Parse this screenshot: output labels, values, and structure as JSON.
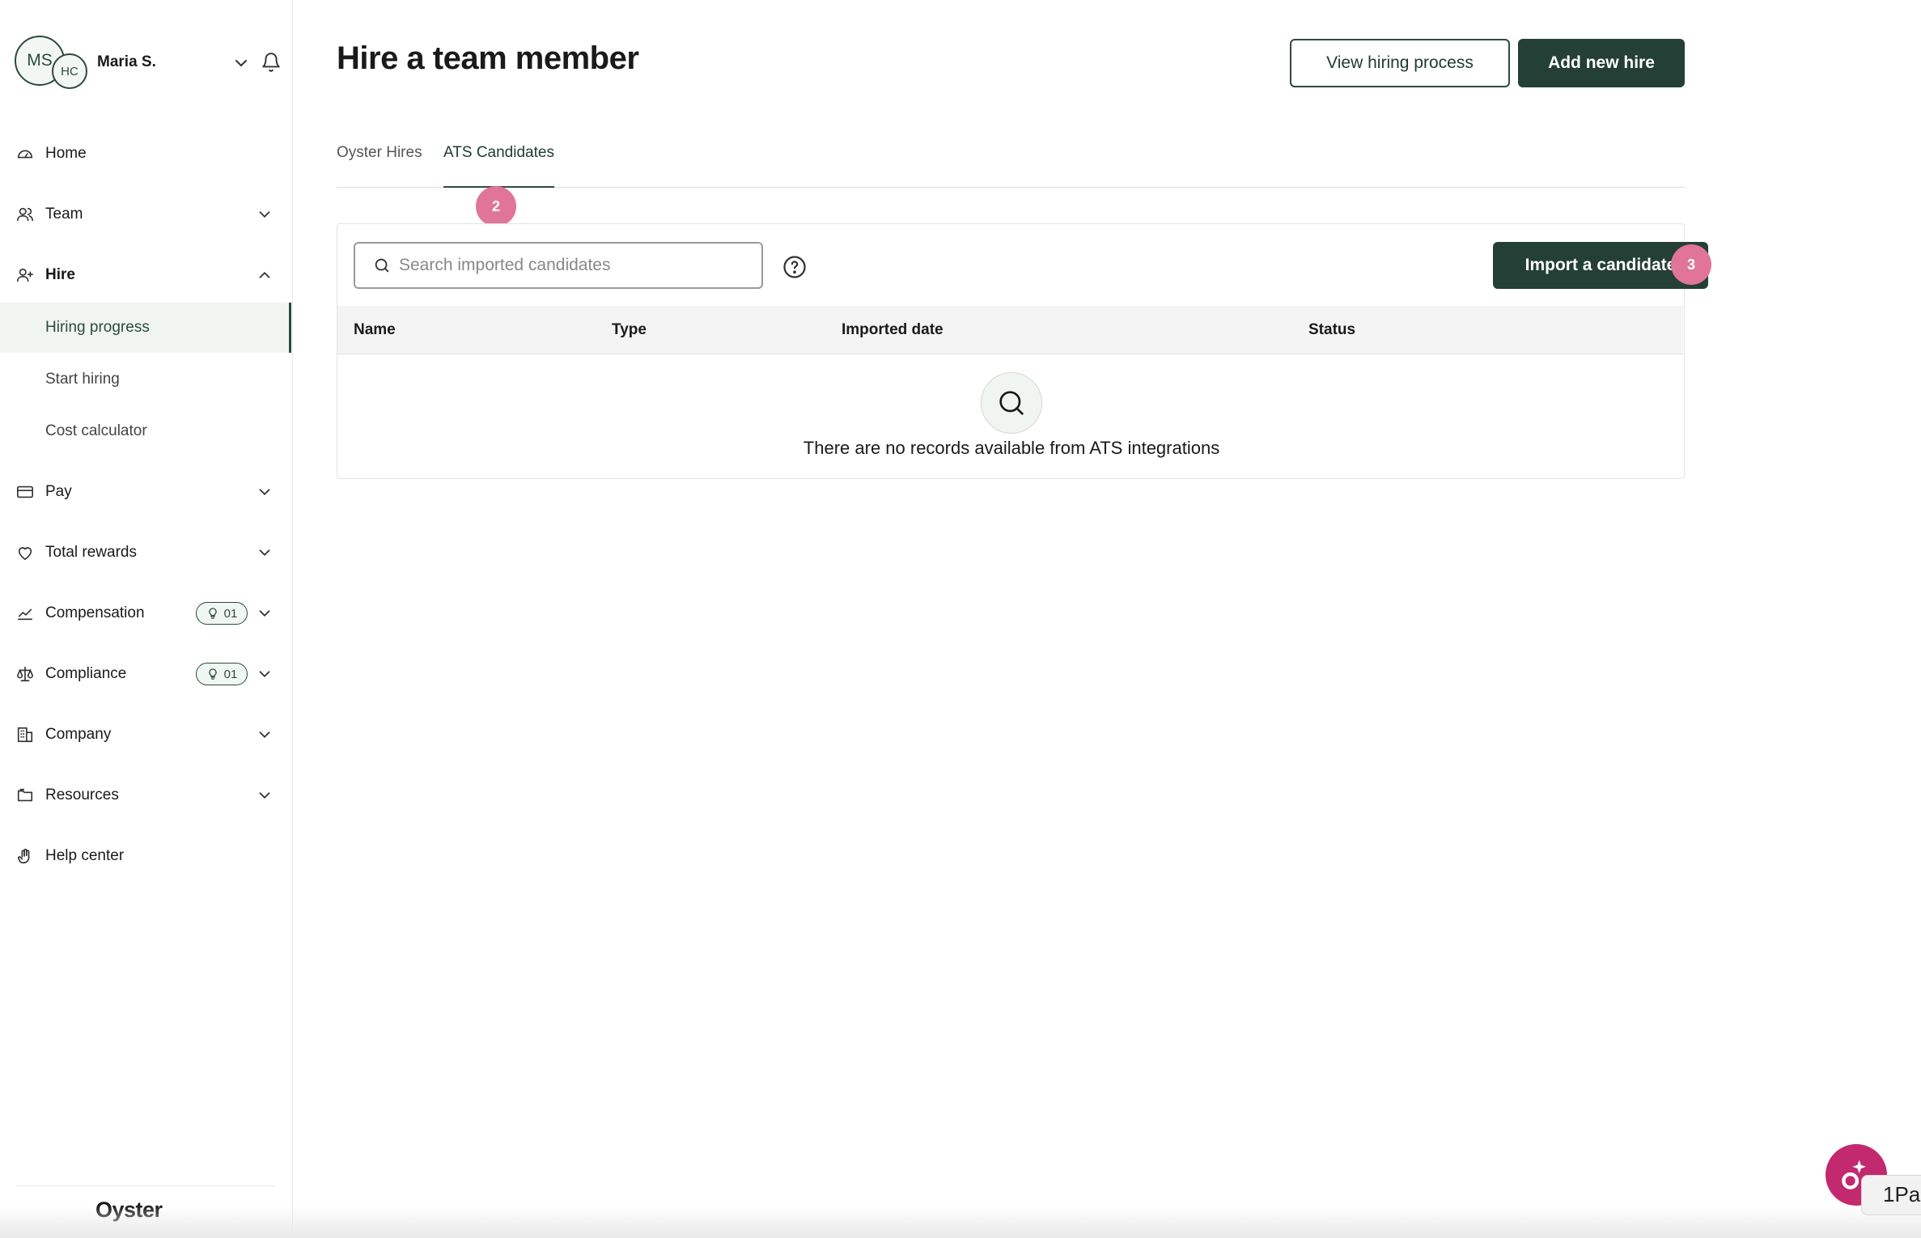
{
  "user": {
    "initials_primary": "MS",
    "initials_secondary": "HC",
    "name": "Maria S."
  },
  "nav": {
    "home": "Home",
    "team": "Team",
    "hire": "Hire",
    "hire_sub": {
      "hiring_progress": "Hiring progress",
      "start_hiring": "Start hiring",
      "cost_calculator": "Cost calculator"
    },
    "pay": "Pay",
    "total_rewards": "Total rewards",
    "compensation": "Compensation",
    "compensation_badge": "01",
    "compliance": "Compliance",
    "compliance_badge": "01",
    "company": "Company",
    "resources": "Resources",
    "help_center": "Help center"
  },
  "brand": "Oyster",
  "header": {
    "title": "Hire a team member",
    "view_hiring_process": "View hiring process",
    "add_new_hire": "Add new hire"
  },
  "tabs": {
    "oyster_hires": "Oyster Hires",
    "ats_candidates": "ATS Candidates"
  },
  "search": {
    "placeholder": "Search imported candidates",
    "value": ""
  },
  "import_button": "Import a candidate",
  "table": {
    "columns": [
      "Name",
      "Type",
      "Imported date",
      "Status"
    ],
    "empty_message": "There are no records available from ATS integrations"
  },
  "annotations": {
    "tab_marker": "2",
    "import_marker": "3"
  },
  "password_manager_label": "1Pa",
  "colors": {
    "primary": "#243f35",
    "accent_badge": "#e07599",
    "fab": "#c2296e"
  }
}
